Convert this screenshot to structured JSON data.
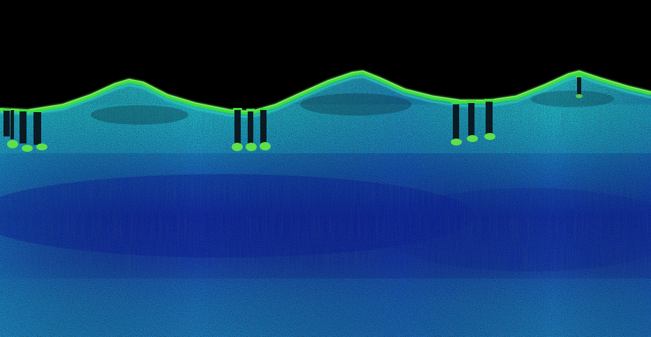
{
  "scene": {
    "palette": {
      "sky": "#000000",
      "surface_green": "#38d93a",
      "surface_highlight": "#7cf26a",
      "cyan": "#24c6d2",
      "teal": "#1a8fb0",
      "blue_mid": "#1b55c8",
      "blue_deep": "#1236b4",
      "blue_lower": "#1a64b8",
      "pile_dark": "#0b1a22",
      "foot_green": "#5ee04a"
    },
    "objects": [
      "sky-region",
      "point-cloud-seabed",
      "surface-ridge",
      "pile-cluster-left",
      "pile-cluster-center",
      "pile-cluster-right",
      "single-pile-far-right"
    ]
  }
}
